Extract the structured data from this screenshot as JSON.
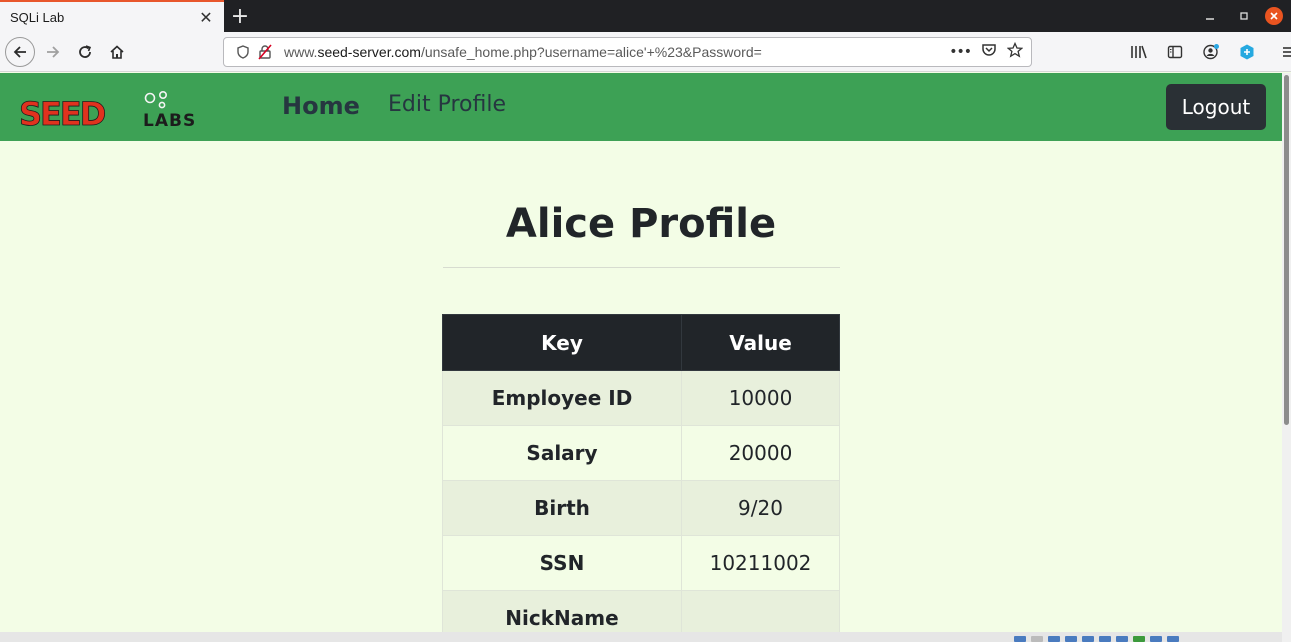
{
  "browser": {
    "tab_title": "SQLi Lab",
    "tab_close": "✕",
    "new_tab": "+",
    "url_prefix": "www.",
    "url_host": "seed-server.com",
    "url_path": "/unsafe_home.php?username=alice'+%23&Password=",
    "url_more": "•••"
  },
  "site": {
    "logo_main": "SEED",
    "logo_sub": "LABS",
    "nav": {
      "home": "Home",
      "edit_profile": "Edit Profile"
    },
    "logout": "Logout",
    "colors": {
      "header": "#3da155",
      "page_bg": "#f3fde6",
      "logo_red": "#e0321e",
      "dark": "#212529"
    }
  },
  "profile": {
    "title": "Alice Profile",
    "columns": {
      "key": "Key",
      "value": "Value"
    },
    "rows": [
      {
        "key": "Employee ID",
        "value": "10000"
      },
      {
        "key": "Salary",
        "value": "20000"
      },
      {
        "key": "Birth",
        "value": "9/20"
      },
      {
        "key": "SSN",
        "value": "10211002"
      },
      {
        "key": "NickName",
        "value": ""
      }
    ]
  }
}
